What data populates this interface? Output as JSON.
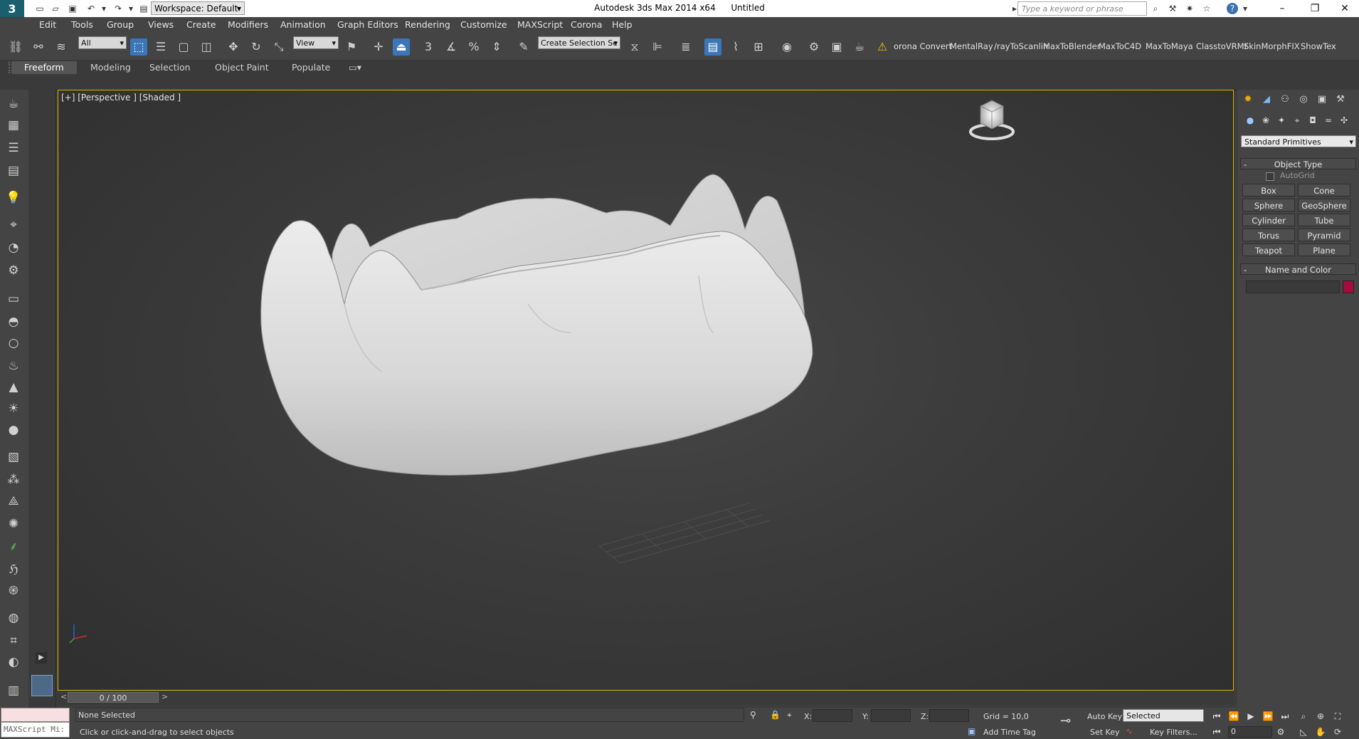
{
  "titlebar": {
    "app_title": "Autodesk 3ds Max  2014 x64",
    "doc_title": "Untitled",
    "workspace": "Workspace: Default",
    "search_placeholder": "Type a keyword or phrase"
  },
  "menus": [
    "Edit",
    "Tools",
    "Group",
    "Views",
    "Create",
    "Modifiers",
    "Animation",
    "Graph Editors",
    "Rendering",
    "Customize",
    "MAXScript",
    "Corona",
    "Help"
  ],
  "toolbar": {
    "selection_filter": "All",
    "ref_coord": "View",
    "selection_set": "Create Selection Se",
    "snap_label": "3",
    "plugins": [
      "orona Convert",
      "MentalRay",
      "/rayToScanlin",
      "MaxToBlender",
      "MaxToC4D",
      "MaxToMaya",
      "ClasstoVRMt",
      "SkinMorphFIX",
      "ShowTex"
    ]
  },
  "ribbon": {
    "tabs": [
      "Freeform",
      "Modeling",
      "Selection",
      "Object Paint",
      "Populate"
    ]
  },
  "viewport": {
    "label": "[+] [Perspective ] [Shaded ]"
  },
  "command_panel": {
    "category": "Standard Primitives",
    "object_type_title": "Object Type",
    "autogrid": "AutoGrid",
    "buttons": [
      "Box",
      "Cone",
      "Sphere",
      "GeoSphere",
      "Cylinder",
      "Tube",
      "Torus",
      "Pyramid",
      "Teapot",
      "Plane"
    ],
    "name_color_title": "Name and Color",
    "color": "#a30d3c"
  },
  "timeslider": {
    "frame": "0 / 100"
  },
  "status": {
    "selection": "None Selected",
    "prompt": "Click or click-and-drag to select objects",
    "maxscript": "MAXScript Mi:",
    "x_label": "X:",
    "y_label": "Y:",
    "z_label": "Z:",
    "grid": "Grid = 10,0",
    "auto_key": "Auto Key",
    "set_key": "Set Key",
    "key_mode": "Selected",
    "key_filters": "Key Filters...",
    "add_time_tag": "Add Time Tag",
    "frame_field": "0"
  }
}
